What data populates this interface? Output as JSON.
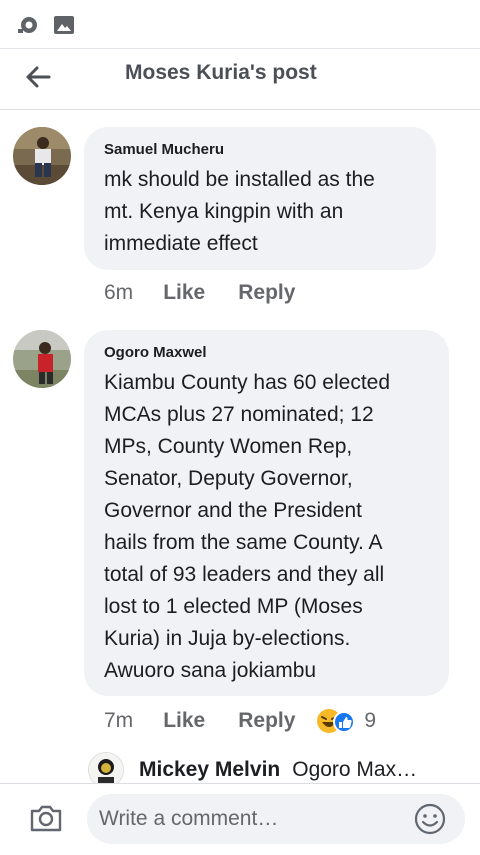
{
  "header": {
    "title": "Moses Kuria's post"
  },
  "comments": [
    {
      "author": "Samuel Mucheru",
      "text": "mk should be installed as the\nmt. Kenya kingpin with an\nimmediate effect",
      "time": "6m",
      "like_label": "Like",
      "reply_label": "Reply"
    },
    {
      "author": "Ogoro Maxwel",
      "text": "Kiambu County has 60 elected\nMCAs plus 27 nominated; 12\nMPs, County Women Rep,\nSenator, Deputy Governor,\nGovernor and the President\nhails from the same County. A\ntotal of 93 leaders and they all\nlost to 1 elected MP (Moses\nKuria) in Juja by-elections.\nAwuoro sana jokiambu",
      "time": "7m",
      "like_label": "Like",
      "reply_label": "Reply",
      "reaction_count": "9",
      "reaction_icons": [
        "laughing-emoji-icon",
        "like-reaction-icon"
      ]
    }
  ],
  "reply_preview": {
    "author": "Mickey Melvin",
    "text": "Ogoro Max…"
  },
  "composer": {
    "placeholder": "Write a comment…"
  },
  "colors": {
    "bubble": "#f0f2f5",
    "muted": "#65676b",
    "like_blue": "#1877f2",
    "laugh_yellow": "#f7b928"
  }
}
